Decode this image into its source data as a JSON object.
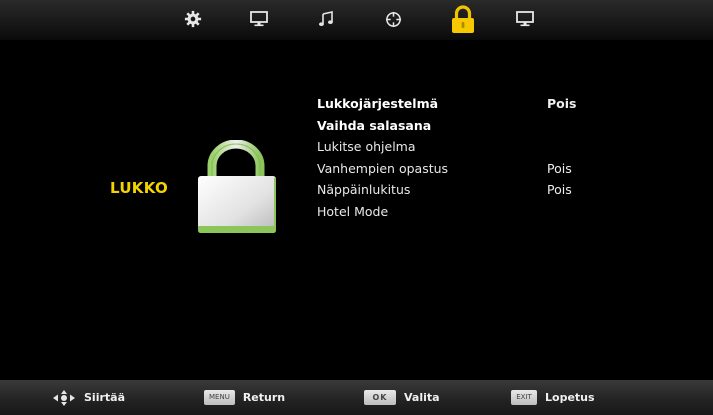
{
  "tabs": [
    {
      "icon": "gear-icon",
      "active": false
    },
    {
      "icon": "monitor-icon",
      "active": false
    },
    {
      "icon": "music-note-icon",
      "active": false
    },
    {
      "icon": "crosshair-icon",
      "active": false
    },
    {
      "icon": "lock-icon",
      "active": true
    },
    {
      "icon": "display-icon",
      "active": false
    }
  ],
  "colors": {
    "accent": "#f2d300",
    "background": "#000000"
  },
  "section": {
    "title": "LUKKO"
  },
  "menu": {
    "items": [
      {
        "label": "Lukkojärjestelmä",
        "value": "Pois"
      },
      {
        "label": "Vaihda salasana",
        "value": ""
      },
      {
        "label": "Lukitse ohjelma",
        "value": ""
      },
      {
        "label": "Vanhempien opastus",
        "value": "Pois"
      },
      {
        "label": "Näppäinlukitus",
        "value": "Pois"
      },
      {
        "label": "Hotel Mode",
        "value": ""
      }
    ]
  },
  "footer": {
    "move": {
      "key_icon": "dpad-icon",
      "label": "Siirtää"
    },
    "menu": {
      "key": "MENU",
      "label": "Return"
    },
    "ok": {
      "key": "OK",
      "label": "Valita"
    },
    "exit": {
      "key": "EXIT",
      "label": "Lopetus"
    }
  }
}
